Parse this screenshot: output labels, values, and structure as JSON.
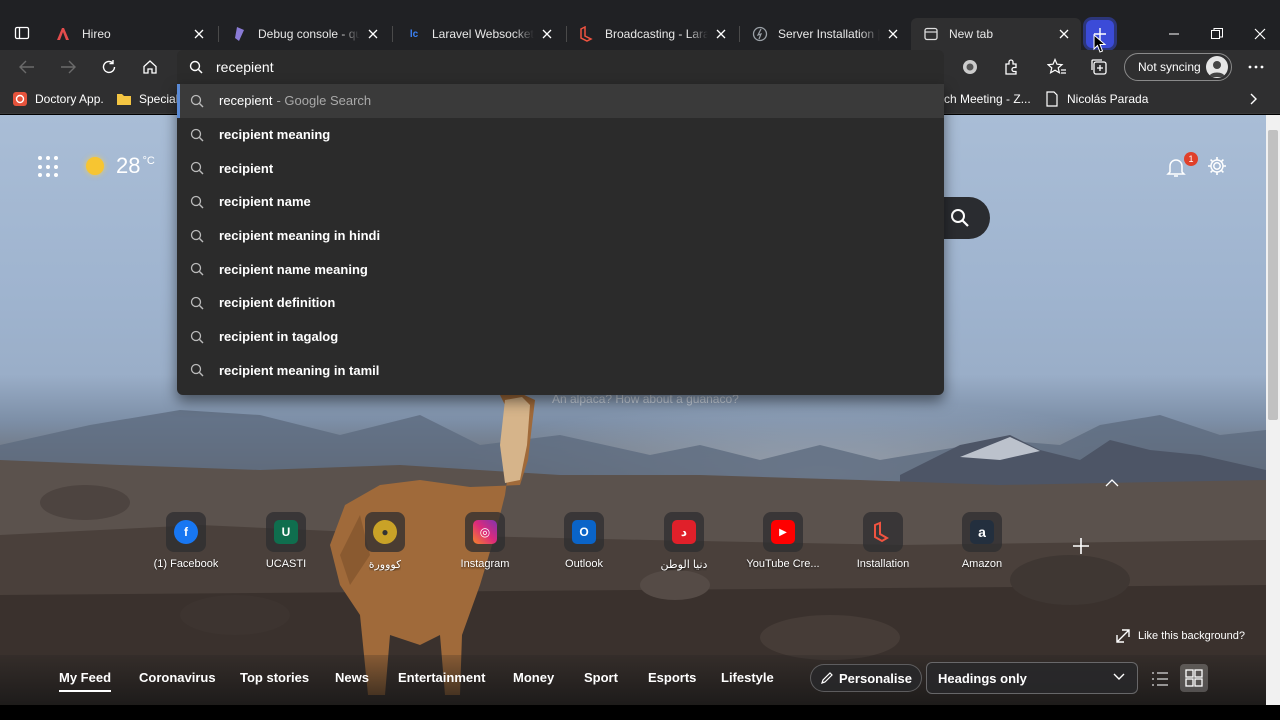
{
  "tabs": [
    {
      "title": "Hireo",
      "favicon": "hireo-logo",
      "color": "#e34c4c",
      "active": false
    },
    {
      "title": "Debug console - quick",
      "favicon": "debug-console-logo",
      "color": "#8a7bd6",
      "active": false
    },
    {
      "title": "Laravel Websockets - ",
      "favicon": "laravel-websockets-logo",
      "color": "#3b82f6",
      "active": false
    },
    {
      "title": "Broadcasting - Laravel",
      "favicon": "laravel-logo",
      "color": "#f05340",
      "active": false
    },
    {
      "title": "Server Installation | So",
      "favicon": "soketi-logo",
      "color": "#9aa0a6",
      "active": false
    },
    {
      "title": "New tab",
      "favicon": "newtab-icon",
      "color": "#dddddd",
      "active": true
    }
  ],
  "toolbar": {
    "sync_label": "Not syncing"
  },
  "favorites": [
    {
      "label": "Doctory App.",
      "icon": "doctory-icon"
    },
    {
      "label": "Special",
      "icon": "folder-icon"
    },
    {
      "label": "ch Meeting - Z...",
      "icon": "zoom-icon"
    },
    {
      "label": "Nicolás Parada",
      "icon": "page-icon"
    }
  ],
  "omnibox": {
    "value": "recepient"
  },
  "suggestions": [
    {
      "text": "recepient",
      "suffix": "- Google Search",
      "selected": true
    },
    {
      "text": "recipient meaning",
      "suffix": "",
      "selected": false
    },
    {
      "text": "recipient",
      "suffix": "",
      "selected": false
    },
    {
      "text": "recipient name",
      "suffix": "",
      "selected": false
    },
    {
      "text": "recipient meaning in hindi",
      "suffix": "",
      "selected": false
    },
    {
      "text": "recipient name meaning",
      "suffix": "",
      "selected": false
    },
    {
      "text": "recipient definition",
      "suffix": "",
      "selected": false
    },
    {
      "text": "recipient in tagalog",
      "suffix": "",
      "selected": false
    },
    {
      "text": "recipient meaning in tamil",
      "suffix": "",
      "selected": false
    }
  ],
  "weather": {
    "temp": "28",
    "unit": "°C"
  },
  "notifications": {
    "count": "1"
  },
  "background": {
    "caption": "An alpaca? How about a guanaco?",
    "like_label": "Like this background?"
  },
  "quick_links": [
    {
      "name": "(1) Facebook",
      "icon": "facebook-icon",
      "bg": "#1877f2",
      "glyph": "f"
    },
    {
      "name": "UCASTI",
      "icon": "ucasti-icon",
      "bg": "#0f6e4e",
      "glyph": "U"
    },
    {
      "name": "كووورة",
      "icon": "kooora-icon",
      "bg": "#c9a227",
      "glyph": "●"
    },
    {
      "name": "Instagram",
      "icon": "instagram-icon",
      "bg": "#d62976",
      "glyph": "◎"
    },
    {
      "name": "Outlook",
      "icon": "outlook-icon",
      "bg": "#0a64c8",
      "glyph": "O"
    },
    {
      "name": "دنيا الوطن",
      "icon": "donya-alwatan-icon",
      "bg": "#e0202a",
      "glyph": "د"
    },
    {
      "name": "YouTube Cre...",
      "icon": "youtube-icon",
      "bg": "#ff0000",
      "glyph": "▶"
    },
    {
      "name": "Installation",
      "icon": "laravel-icon",
      "bg": "#f05340",
      "glyph": "L"
    },
    {
      "name": "Amazon",
      "icon": "amazon-icon",
      "bg": "#232f3e",
      "glyph": "a"
    }
  ],
  "feed_tabs": [
    "My Feed",
    "Coronavirus",
    "Top stories",
    "News",
    "Entertainment",
    "Money",
    "Sport",
    "Esports",
    "Lifestyle"
  ],
  "feed_controls": {
    "personalise_label": "Personalise",
    "layout_option": "Headings only"
  }
}
